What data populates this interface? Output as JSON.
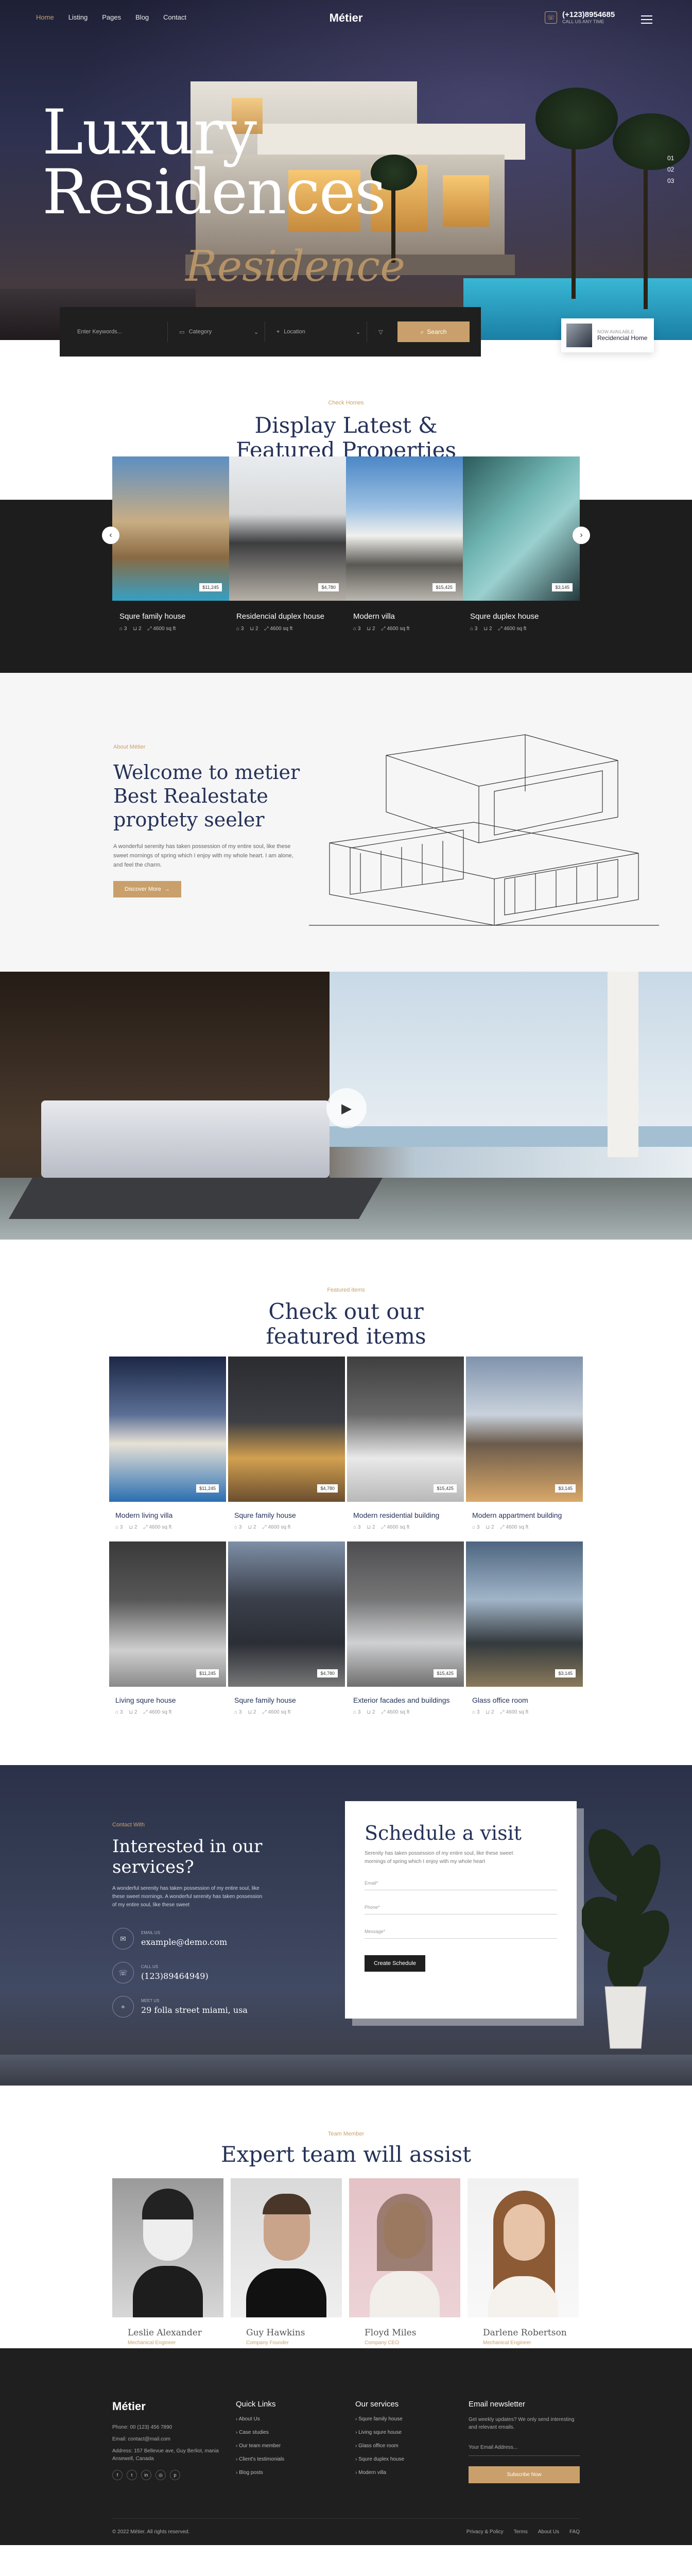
{
  "brand": {
    "logo": "Métier",
    "accent": "#c9a06b",
    "navy": "#253158"
  },
  "nav": {
    "items": [
      "Home",
      "Listing",
      "Pages",
      "Blog",
      "Contact"
    ]
  },
  "header": {
    "phone": "(+123)8954685",
    "phone_sub": "CALL US ANY TIME"
  },
  "hero": {
    "title_line1": "Luxury",
    "title_line2": "Residences",
    "script": "Residence",
    "slides": [
      "01",
      "02",
      "03"
    ]
  },
  "search": {
    "keyword_placeholder": "Enter Keywords...",
    "category": "Category",
    "location": "Location",
    "button": "Search"
  },
  "hero_card": {
    "small": "NOW AVAILABLE",
    "title": "Recidencial Home"
  },
  "display": {
    "eyebrow": "Check Homes",
    "title_line1": "Display Latest &",
    "title_line2": "Featured Properties",
    "cards": [
      {
        "name": "Squre family house",
        "price": "$11,245",
        "beds": "3",
        "baths": "2",
        "area": "4600 sq ft"
      },
      {
        "name": "Residencial duplex house",
        "price": "$4,780",
        "beds": "3",
        "baths": "2",
        "area": "4600 sq ft"
      },
      {
        "name": "Modern villa",
        "price": "$15,425",
        "beds": "3",
        "baths": "2",
        "area": "4600 sq ft"
      },
      {
        "name": "Squre duplex house",
        "price": "$3,145",
        "beds": "3",
        "baths": "2",
        "area": "4600 sq ft"
      }
    ]
  },
  "welcome": {
    "eyebrow": "About Métier",
    "title_line1": "Welcome to metier",
    "title_line2": "Best Realestate",
    "title_line3": "proptety seeler",
    "body": "A wonderful serenity has taken possession of my entire soul, like these sweet mornings of spring which I enjoy with my whole heart. I am alone, and feel the charm.",
    "button": "Discover More"
  },
  "featured": {
    "eyebrow": "Featured items",
    "title_line1": "Check out our",
    "title_line2": "featured items",
    "cards": [
      {
        "name": "Modern living villa",
        "price": "$11,245",
        "beds": "3",
        "baths": "2",
        "area": "4600 sq ft"
      },
      {
        "name": "Squre family house",
        "price": "$4,780",
        "beds": "3",
        "baths": "2",
        "area": "4600 sq ft"
      },
      {
        "name": "Modern residential building",
        "price": "$15,425",
        "beds": "3",
        "baths": "2",
        "area": "4600 sq ft"
      },
      {
        "name": "Modern appartment building",
        "price": "$3,145",
        "beds": "3",
        "baths": "2",
        "area": "4600 sq ft"
      },
      {
        "name": "Living squre house",
        "price": "$11,245",
        "beds": "3",
        "baths": "2",
        "area": "4600 sq ft"
      },
      {
        "name": "Squre family house",
        "price": "$4,780",
        "beds": "3",
        "baths": "2",
        "area": "4600 sq ft"
      },
      {
        "name": "Exterior facades and buildings",
        "price": "$15,425",
        "beds": "3",
        "baths": "2",
        "area": "4600 sq ft"
      },
      {
        "name": "Glass office room",
        "price": "$3,145",
        "beds": "3",
        "baths": "2",
        "area": "4600 sq ft"
      }
    ]
  },
  "contact": {
    "eyebrow": "Contact With",
    "title_line1": "Interested in our",
    "title_line2": "services?",
    "body": "A wonderful serenity has taken possession of my entire soul, like these sweet mornings. A wonderful serenity has taken possession of my entire soul, like these sweet",
    "items": [
      {
        "label": "EMAIL US",
        "value": "example@demo.com"
      },
      {
        "label": "CALL US",
        "value": "(123)89464949)"
      },
      {
        "label": "MEET US",
        "value": "29 folla street miami, usa"
      }
    ]
  },
  "schedule": {
    "title": "Schedule a visit",
    "body": "Serenity has taken possession of my entire soul, like these sweet mornings of spring which I enjoy with my whole heart",
    "email": "Email*",
    "phone": "Phone*",
    "message": "Message*",
    "button": "Create Schedule"
  },
  "team": {
    "eyebrow": "Team Member",
    "title": "Expert team will assist",
    "members": [
      {
        "name": "Leslie Alexander",
        "role": "Mechanical Engineer"
      },
      {
        "name": "Guy Hawkins",
        "role": "Company Founder"
      },
      {
        "name": "Floyd Miles",
        "role": "Company CEO"
      },
      {
        "name": "Darlene Robertson",
        "role": "Mechanical Engineer"
      }
    ]
  },
  "footer": {
    "logo": "Métier",
    "phone": "Phone: 00 (123) 456 7890",
    "email": "Email: contact@mail.com",
    "address": "Address: 157 Bellevue ave, Guy Berliot, mania Ansewell, Canada",
    "social": [
      "f",
      "t",
      "in",
      "◎",
      "p"
    ],
    "quick_title": "Quick Links",
    "quick_links": [
      "About Us",
      "Case studies",
      "Our team member",
      "Client's testimonials",
      "Blog posts"
    ],
    "services_title": "Our services",
    "services": [
      "Squre family house",
      "Living squre house",
      "Glass office room",
      "Squre duplex house",
      "Modern villa"
    ],
    "newsletter_title": "Email newsletter",
    "newsletter_body": "Get weekly updates? We only send interesting and relevant emails.",
    "newsletter_placeholder": "Your Email Address...",
    "newsletter_button": "Subscribe Now",
    "copyright": "© 2022 Métier. All rights reserved.",
    "bottom_links": [
      "Privacy & Policy",
      "Terms",
      "About Us",
      "FAQ"
    ]
  }
}
